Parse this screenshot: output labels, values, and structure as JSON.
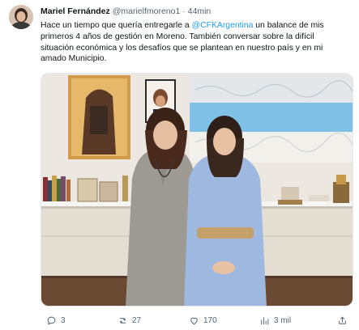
{
  "tweet": {
    "author_name": "Mariel Fernández",
    "handle": "@marielfmoreno1",
    "separator": "·",
    "time": "44min",
    "text_part1": "Hace un tiempo que quería entregarle a ",
    "mention": "@CFKArgentina",
    "text_part2": " un balance de mis primeros 4 años de gestión en Moreno. También conversar sobre la difícil situación económica y los desafíos que se plantean en nuestro país y en mi amado Municipio."
  },
  "actions": {
    "replies": "3",
    "reposts": "27",
    "likes": "170",
    "views": "3 mil"
  },
  "icons": {
    "reply": "reply-icon",
    "repost": "repost-icon",
    "like": "heart-icon",
    "views": "views-chart-icon",
    "share": "share-icon"
  },
  "colors": {
    "accent": "#1d9bf0",
    "secondary_text": "#536471",
    "primary_text": "#0f1419"
  }
}
